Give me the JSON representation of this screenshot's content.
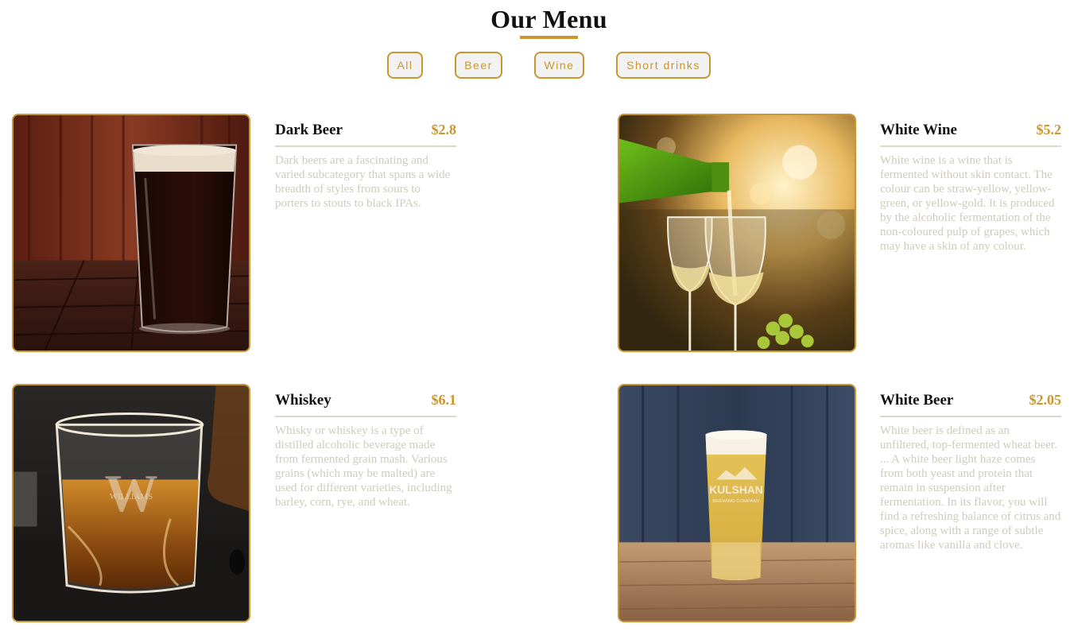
{
  "menu": {
    "title": "Our Menu",
    "filters": [
      "All",
      "Beer",
      "Wine",
      "Short drinks"
    ],
    "accent_color": "#c9962f",
    "items": [
      {
        "name": "Dark Beer",
        "price": "$2.8",
        "description": "Dark beers are a fascinating and varied subcategory that spans a wide breadth of styles from sours to porters to stouts to black IPAs.",
        "image": "dark-beer-glass-photo"
      },
      {
        "name": "White Wine",
        "price": "$5.2",
        "description": "White wine is a wine that is fermented without skin contact. The colour can be straw-yellow, yellow-green, or yellow-gold. It is produced by the alcoholic fermentation of the non-coloured pulp of grapes, which may have a skin of any colour.",
        "image": "white-wine-pour-photo"
      },
      {
        "name": "Whiskey",
        "price": "$6.1",
        "description": "Whisky or whiskey is a type of distilled alcoholic beverage made from fermented grain mash. Various grains (which may be malted) are used for different varieties, including barley, corn, rye, and wheat.",
        "image": "whiskey-glass-photo",
        "glass_engraving": "WILLIAMS"
      },
      {
        "name": "White Beer",
        "price": "$2.05",
        "description": "White beer is defined as an unfiltered, top-fermented wheat beer. ... A white beer light haze comes from both yeast and protein that remain in suspension after fermentation. In its flavor, you will find a refreshing balance of citrus and spice, along with a range of subtle aromas like vanilla and clove.",
        "image": "white-beer-glass-photo",
        "glass_brand": "KULSHAN",
        "glass_brand_sub": "BREWING COMPANY"
      }
    ]
  }
}
